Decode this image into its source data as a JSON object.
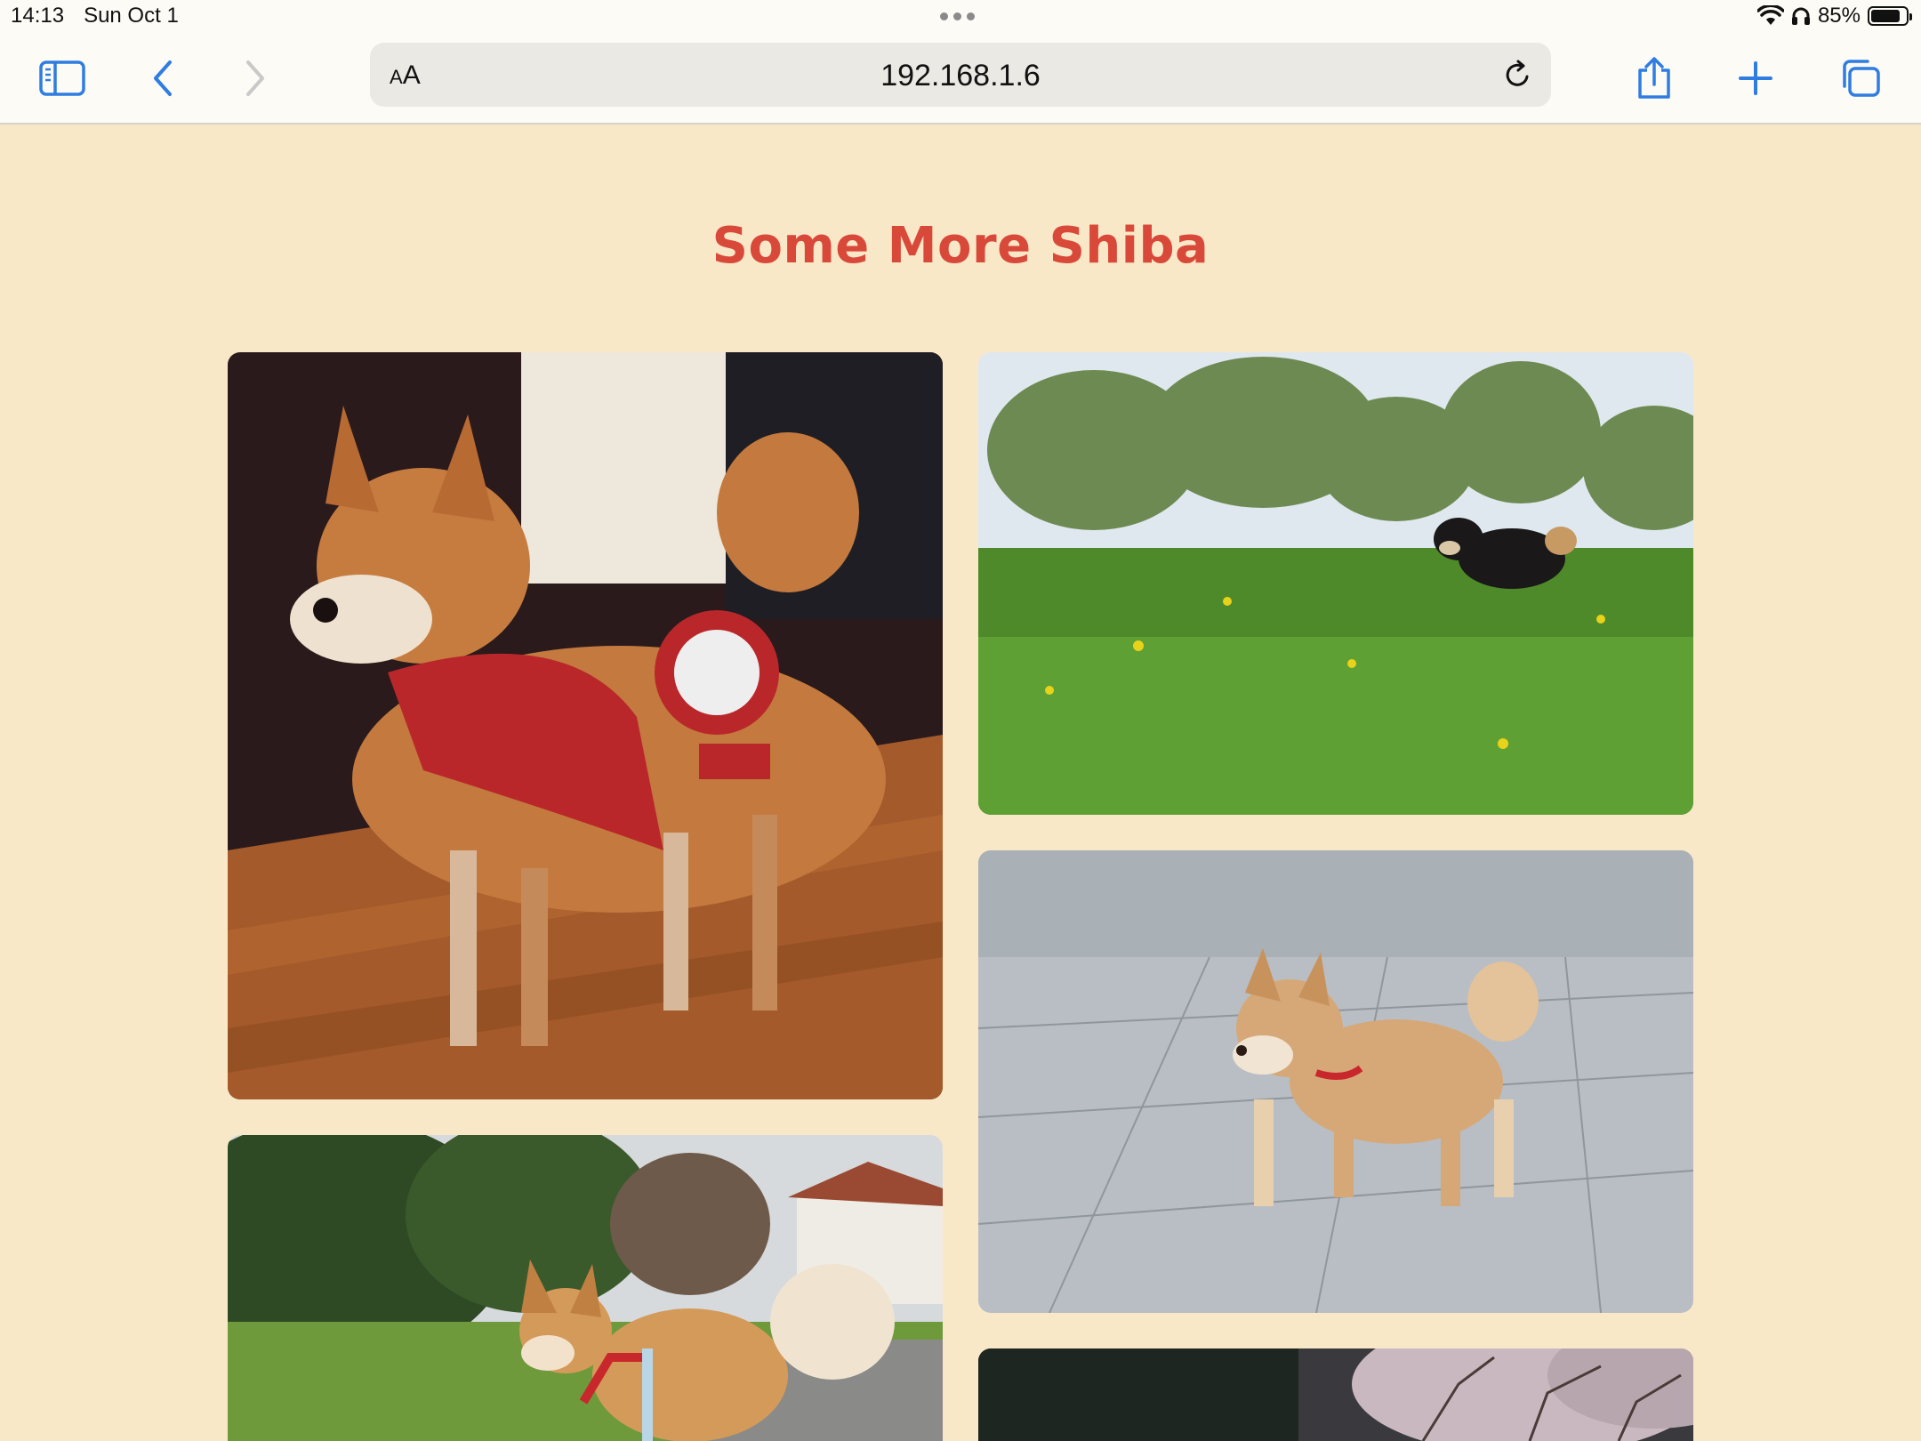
{
  "status": {
    "time": "14:13",
    "date": "Sun Oct 1",
    "battery_percent": "85%",
    "battery_level": 0.85
  },
  "toolbar": {
    "sidebar_icon": "sidebar-icon",
    "back_icon": "chevron-left-icon",
    "forward_icon": "chevron-right-icon",
    "reader_small": "A",
    "reader_big": "A",
    "url": "192.168.1.6",
    "reload_icon": "reload-icon",
    "share_icon": "share-icon",
    "new_tab_icon": "plus-icon",
    "tabs_icon": "tabs-icon",
    "accent_color": "#2f7de1"
  },
  "page": {
    "title": "Some More Shiba",
    "title_color": "#d9493a",
    "background": "#f9e8c8",
    "photos": [
      {
        "subject": "shiba-in-49ers-scarf"
      },
      {
        "subject": "black-shiba-in-meadow"
      },
      {
        "subject": "shiba-puppy-on-pavement"
      },
      {
        "subject": "shiba-on-leash-in-park"
      },
      {
        "subject": "shiba-under-blossom-trees"
      }
    ]
  }
}
